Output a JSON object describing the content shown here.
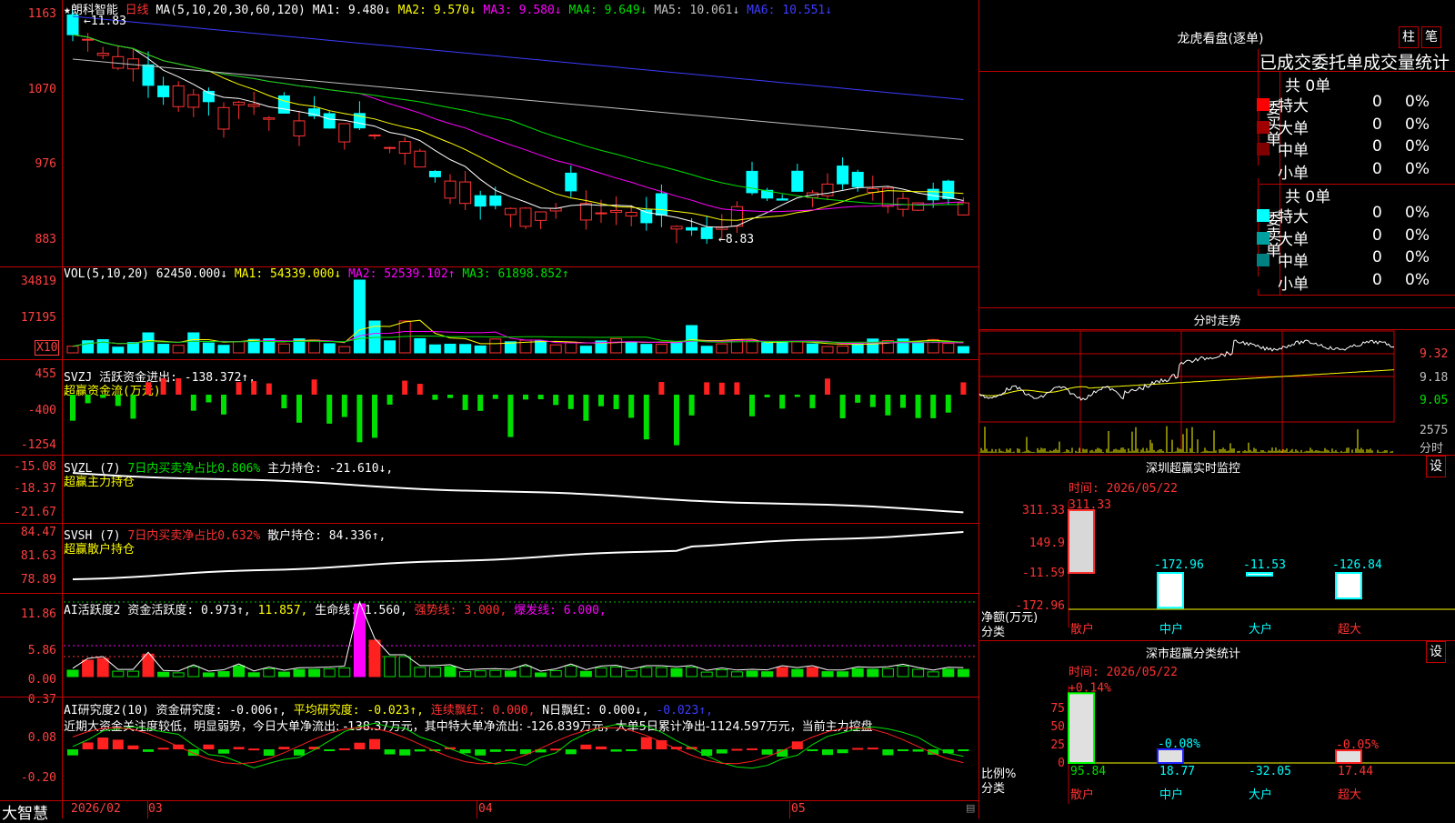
{
  "main_chart": {
    "stock_name": "★朗科智能",
    "period": "日线",
    "ma_params": "MA(5,10,20,30,60,120)",
    "ma_values": [
      {
        "label": "MA1: 9.480↓",
        "color": "#ffffff"
      },
      {
        "label": "MA2: 9.570↓",
        "color": "#ffff00"
      },
      {
        "label": "MA3: 9.580↓",
        "color": "#ff00ff"
      },
      {
        "label": "MA4: 9.649↓",
        "color": "#00e000"
      },
      {
        "label": "MA5: 10.061↓",
        "color": "#c0c0c0"
      },
      {
        "label": "MA6: 10.551↓",
        "color": "#3c3cff"
      }
    ],
    "y_ticks": [
      "1163",
      "1070",
      "976",
      "883"
    ],
    "high_mark": "11.83",
    "low_mark": "8.83"
  },
  "vol_panel": {
    "header": "VOL(5,10,20)",
    "value": "62450.000↓",
    "ma1": "MA1: 54339.000↓",
    "ma2": "MA2: 52539.102↑",
    "ma3": "MA3: 61898.852↑",
    "y_ticks": [
      "34819",
      "17195"
    ],
    "unit": "X10"
  },
  "svzj_panel": {
    "header": "SVZJ  活跃资金进出: -138.372↑,",
    "subtitle": "超赢资金流(万元)",
    "y_ticks": [
      "455",
      "-400",
      "-1254"
    ]
  },
  "svzl_panel": {
    "header": "SVZL (7)",
    "pct": "7日内买卖净占比0.806%",
    "extra": "主力持仓: -21.610↓,",
    "subtitle": "超赢主力持仓",
    "y_ticks": [
      "-15.08",
      "-18.37",
      "-21.67"
    ]
  },
  "svsh_panel": {
    "header": "SVSH (7)",
    "pct": "7日内买卖净占比0.632%",
    "extra": "散户持仓: 84.336↑,",
    "subtitle": "超赢散户持仓",
    "y_ticks": [
      "84.47",
      "81.63",
      "78.89"
    ]
  },
  "ai_active_panel": {
    "header": "AI活跃度2",
    "parts": [
      {
        "text": "资金活跃度: 0.973↑,",
        "color": "#ffffff"
      },
      {
        "text": "11.857,",
        "color": "#ffff00"
      },
      {
        "text": "生命线: 1.560,",
        "color": "#ffffff"
      },
      {
        "text": "强势线: 3.000,",
        "color": "#ff3232"
      },
      {
        "text": "爆发线: 6.000,",
        "color": "#ff00ff"
      }
    ],
    "y_ticks": [
      "11.86",
      "5.86",
      "0.00"
    ]
  },
  "ai_research_panel": {
    "header": "AI研究度2(10)",
    "parts": [
      {
        "text": "资金研究度: -0.006↑,",
        "color": "#ffffff"
      },
      {
        "text": "平均研究度: -0.023↑,",
        "color": "#ffff00"
      },
      {
        "text": "连续飘红: 0.000,",
        "color": "#ff3232"
      },
      {
        "text": "N日飘红: 0.000↓,",
        "color": "#ffffff"
      },
      {
        "text": "-0.023↑,",
        "color": "#3c3cff"
      }
    ],
    "comment": "近期大资金关注度较低，明显弱势，今日大单净流出: -138.37万元，其中特大单净流出: -126.839万元，大单5日累计净出-1124.597万元，当前主力控盘",
    "y_ticks": [
      "0.37",
      "0.08",
      "-0.20"
    ]
  },
  "x_axis": {
    "brand": "大智慧",
    "labels": [
      "2026/02",
      "03",
      "04",
      "05"
    ]
  },
  "right_panel": {
    "lhb_title": "龙虎看盘(逐单)",
    "btn_bar": "柱",
    "btn_pen": "笔",
    "stats_title": "已成交委托单成交量统计",
    "buy_label": "委买单",
    "sell_label": "委卖单",
    "buy_total": "共 0单",
    "sell_total": "共 0单",
    "buy_rows": [
      {
        "name": "特大",
        "count": "0",
        "pct": "0%",
        "color": "#ff0000"
      },
      {
        "name": "大单",
        "count": "0",
        "pct": "0%",
        "color": "#a00000"
      },
      {
        "name": "中单",
        "count": "0",
        "pct": "0%",
        "color": "#800000"
      },
      {
        "name": "小单",
        "count": "0",
        "pct": "0%",
        "color": "#000000"
      }
    ],
    "sell_rows": [
      {
        "name": "特大",
        "count": "0",
        "pct": "0%",
        "color": "#00ffff"
      },
      {
        "name": "大单",
        "count": "0",
        "pct": "0%",
        "color": "#00a0a0"
      },
      {
        "name": "中单",
        "count": "0",
        "pct": "0%",
        "color": "#008080"
      },
      {
        "name": "小单",
        "count": "0",
        "pct": "0%",
        "color": "#000000"
      }
    ],
    "intraday_title": "分时走势",
    "intraday_y": [
      "9.32",
      "9.18",
      "9.05"
    ],
    "intraday_vol": "2575",
    "intraday_vol_unit": "分时",
    "sz_monitor": {
      "title": "深圳超赢实时监控",
      "btn": "设",
      "time": "时间: 2026/05/22",
      "y_ticks": [
        "311.33",
        "149.9",
        "-11.59",
        "-172.96"
      ],
      "unit_label": "净额(万元)",
      "cat_label": "分类",
      "bars": [
        {
          "cat": "散户",
          "label": "311.33",
          "value": 311.33
        },
        {
          "cat": "中户",
          "label": "-172.96",
          "value": -172.96
        },
        {
          "cat": "大户",
          "label": "-11.53",
          "value": -11.53
        },
        {
          "cat": "超大",
          "label": "-126.84",
          "value": -126.84
        }
      ]
    },
    "sz_class": {
      "title": "深市超赢分类统计",
      "btn": "设",
      "time": "时间: 2026/05/22",
      "y_ticks": [
        "75",
        "50",
        "25",
        "0"
      ],
      "unit_label": "比例%",
      "cat_label": "分类",
      "bars": [
        {
          "cat": "散户",
          "pct_label": "+0.14%",
          "value": 95.84,
          "bottom": "95.84",
          "color": "#00ff00"
        },
        {
          "cat": "中户",
          "pct_label": "-0.08%",
          "value": 18.77,
          "bottom": "18.77",
          "color": "#2020ff"
        },
        {
          "cat": "大户",
          "pct_label": "",
          "value": 0,
          "bottom": "-32.05",
          "color": "#00ffff"
        },
        {
          "cat": "超大",
          "pct_label": "-0.05%",
          "value": 17.44,
          "bottom": "17.44",
          "color": "#ff2020"
        }
      ]
    }
  },
  "colors": {
    "up": "#ff3232",
    "down": "#00ffff",
    "grid": "#c00000"
  }
}
